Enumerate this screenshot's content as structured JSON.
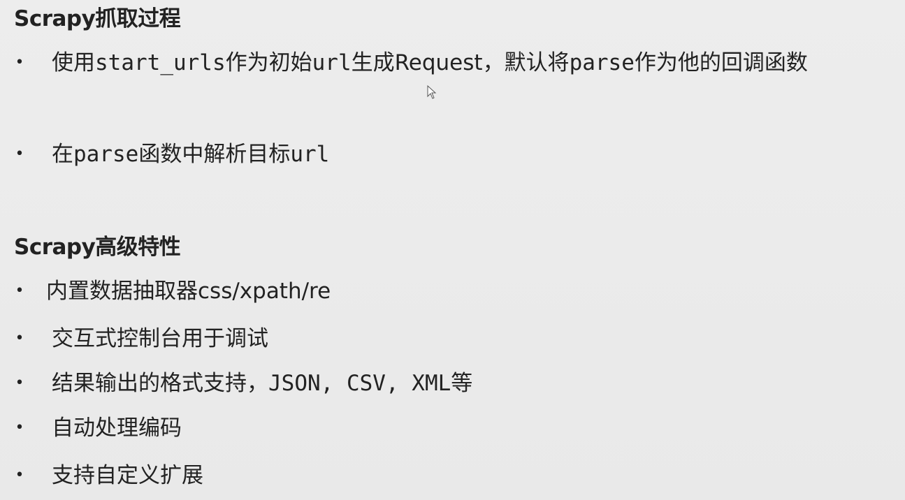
{
  "section1": {
    "title": "Scrapy抓取过程",
    "items": [
      {
        "parts": [
          "使用",
          "start_urls",
          "作为初始",
          "url",
          "生成Request，默认将",
          "parse",
          "作为他的回调函数"
        ]
      },
      {
        "parts": [
          "在",
          "parse",
          "函数中解析目标",
          "url"
        ]
      }
    ]
  },
  "section2": {
    "title": "Scrapy高级特性",
    "items": [
      {
        "text": "内置数据抽取器css/xpath/re"
      },
      {
        "text": "交互式控制台用于调试"
      },
      {
        "parts": [
          "结果输出的格式支持，",
          "JSON, CSV, XML",
          "等"
        ]
      },
      {
        "text": "自动处理编码"
      },
      {
        "text": "支持自定义扩展"
      }
    ]
  },
  "bullet_glyph": "•",
  "icons": {
    "cursor": "mouse-pointer-icon"
  }
}
